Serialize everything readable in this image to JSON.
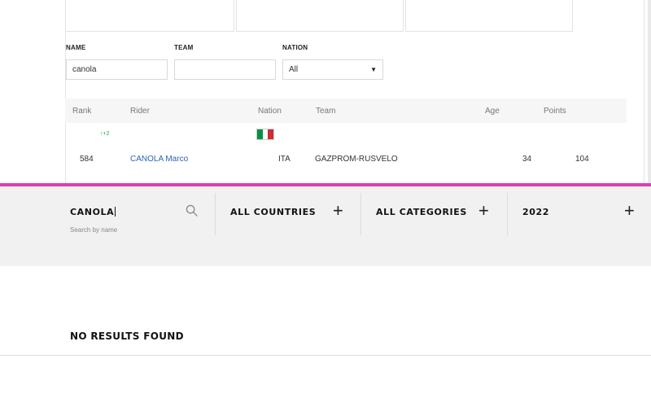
{
  "top_panel": {
    "filters": {
      "name_label": "NAME",
      "name_value": "canola",
      "team_label": "TEAM",
      "team_value": "",
      "nation_label": "NATION",
      "nation_value": "All"
    },
    "table": {
      "headers": [
        "Rank",
        "Rider",
        "Nation",
        "Team",
        "Age",
        "Points"
      ],
      "rows": [
        {
          "rank": "584",
          "trend": "↑+2",
          "rider": "CANOLA Marco",
          "nation": "ITA",
          "team": "GAZPROM-RUSVELO",
          "age": "34",
          "points": "104"
        }
      ]
    },
    "flag_colors": [
      "#009246",
      "#ffffff",
      "#ce2b37"
    ]
  },
  "filter_bar": {
    "search_value": "CANOLA",
    "search_hint": "Search by name",
    "countries_label": "ALL COUNTRIES",
    "categories_label": "ALL CATEGORIES",
    "year_label": "2022",
    "plus_symbol": "+"
  },
  "results": {
    "message": "NO RESULTS FOUND"
  },
  "colors": {
    "divider": "#dd3fb3",
    "link": "#2b63b4",
    "trend_up": "#2aa84a",
    "filter_bar_bg": "#f1f1f1"
  },
  "icons": {
    "search": "search-icon",
    "plus": "plus-icon",
    "dropdown": "chevron-down-icon"
  }
}
